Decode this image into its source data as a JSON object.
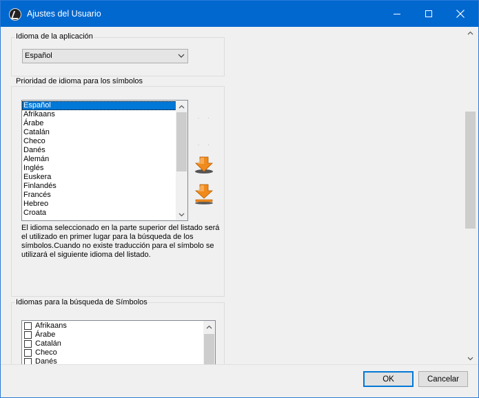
{
  "window": {
    "title": "Ajustes del Usuario"
  },
  "app_language": {
    "group_title": "Idioma de la aplicación",
    "selected": "Español"
  },
  "symbol_priority": {
    "group_title": "Prioridad de idioma para los símbolos",
    "items": [
      "Español",
      "Afrikaans",
      "Árabe",
      "Catalán",
      "Checo",
      "Danés",
      "Alemán",
      "Inglés",
      "Euskera",
      "Finlandés",
      "Francés",
      "Hebreo",
      "Croata"
    ],
    "selected_index": 0,
    "description": "El idioma seleccionado en la parte superior del listado será el utilizado en primer lugar para la búsqueda de los símbolos.Cuando no existe traducción para el símbolo se utilizará el siguiente idioma del listado."
  },
  "search_languages": {
    "group_title": "Idiomas para la búsqueda de Símbolos",
    "items": [
      "Afrikaans",
      "Árabe",
      "Catalán",
      "Checo",
      "Danés"
    ]
  },
  "footer": {
    "ok_label": "OK",
    "cancel_label": "Cancelar"
  },
  "colors": {
    "titlebar": "#0168d0",
    "selection": "#0078d7",
    "arrow_orange": "#f08a1c"
  },
  "icons": {
    "move_down": "orange-down-arrow-icon",
    "move_bottom": "orange-down-arrow-line-icon"
  }
}
